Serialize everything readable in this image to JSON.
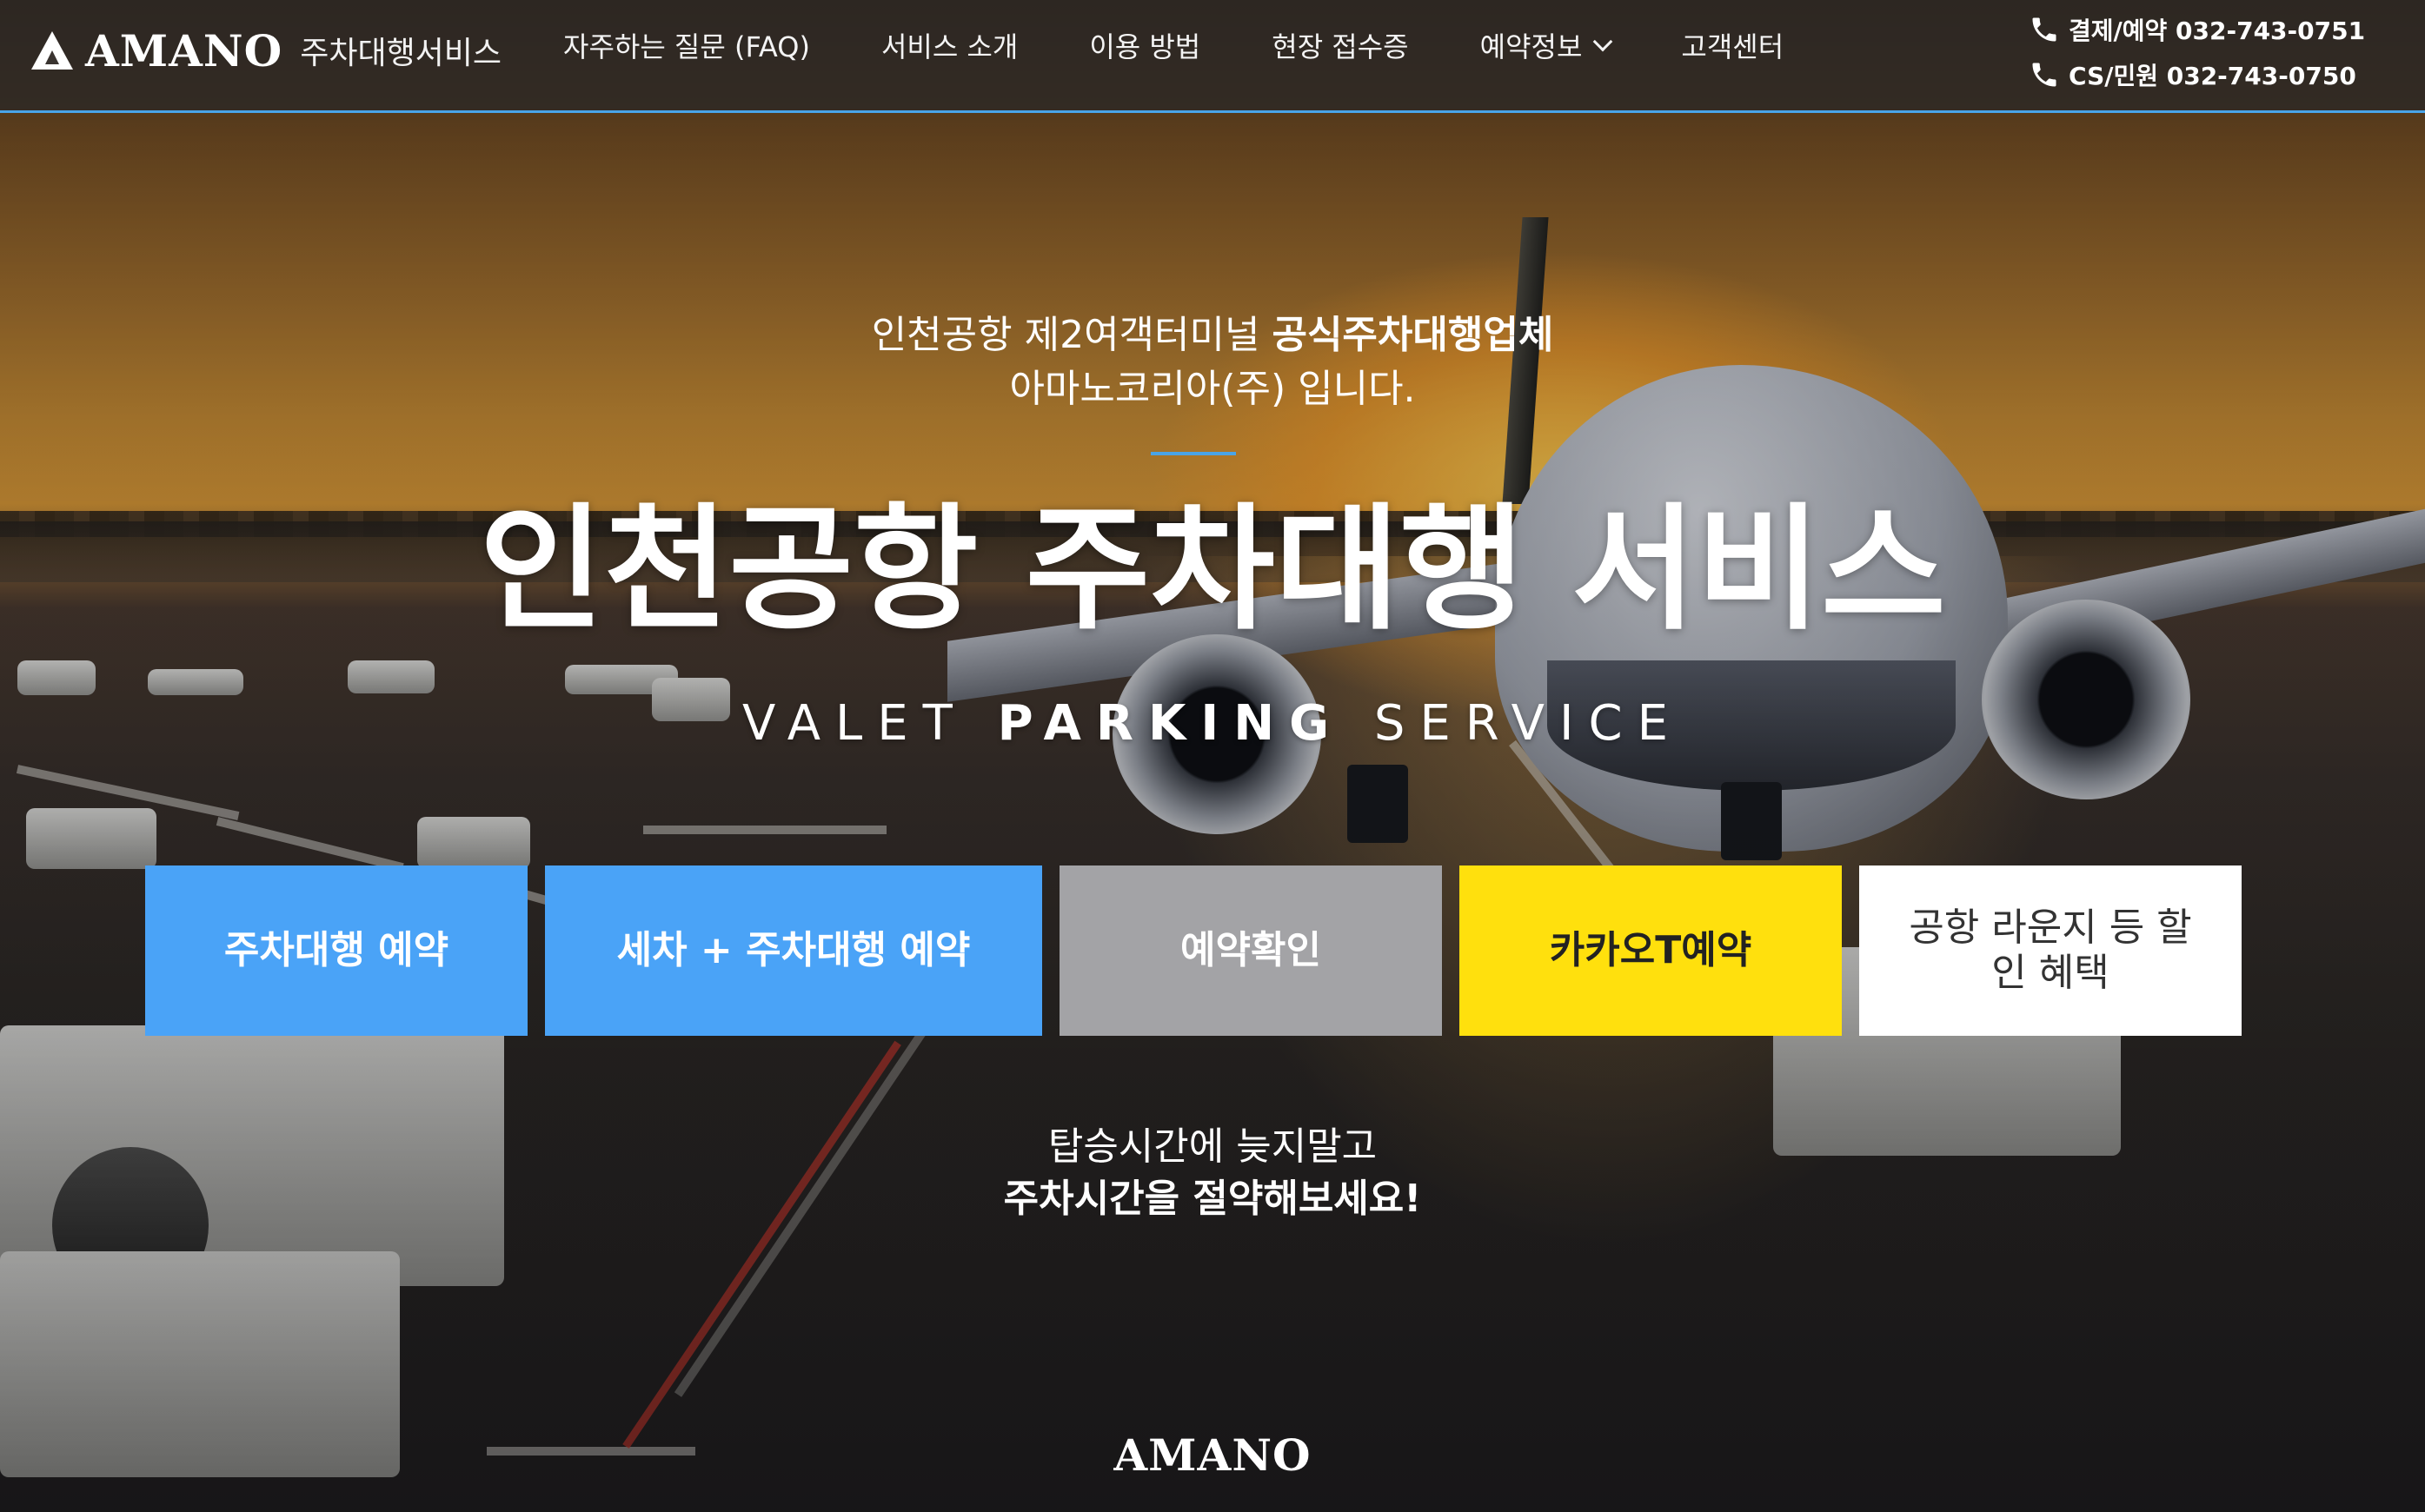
{
  "brand": {
    "logo_word": "AMANO",
    "logo_sub": "주차대행서비스",
    "footer_logo": "AMANO",
    "accent_color": "#49a4e8"
  },
  "nav": {
    "items": [
      {
        "label": "자주하는 질문 (FAQ)"
      },
      {
        "label": "서비스 소개"
      },
      {
        "label": "이용 방법"
      },
      {
        "label": "현장 접수증"
      },
      {
        "label": "예약정보",
        "has_dropdown": true
      },
      {
        "label": "고객센터"
      }
    ]
  },
  "contact": {
    "payment": "결제/예약 032-743-0751",
    "cs": "CS/민원 032-743-0750",
    "icon": "phone-icon"
  },
  "hero": {
    "intro_line1_regular": "인천공항 제2여객터미널 ",
    "intro_line1_bold": "공식주차대행업체",
    "intro_line2": "아마노코리아(주) 입니다.",
    "headline_regular": "인천공항 ",
    "headline_bold": "주차대행 서비스",
    "subhead_1": "VALET ",
    "subhead_2": "PARKING",
    "subhead_3": " SERVICE",
    "tagline_line1": "탑승시간에 늦지말고",
    "tagline_line2": "주차시간을 절약해보세요!"
  },
  "buttons": {
    "valet_reserve": {
      "label": "주차대행 예약",
      "color": "#4aa3f7"
    },
    "wash_valet_reserve": {
      "label": "세차 + 주차대행 예약",
      "color": "#4aa3f7"
    },
    "check_reservation": {
      "label": "예약확인",
      "color": "#a3a3a6"
    },
    "kakao_t": {
      "label": "카카오T예약",
      "color": "#ffe00d"
    },
    "lounge_discount": {
      "label": "공항 라운지 등 할인 혜택",
      "color": "#ffffff"
    }
  }
}
